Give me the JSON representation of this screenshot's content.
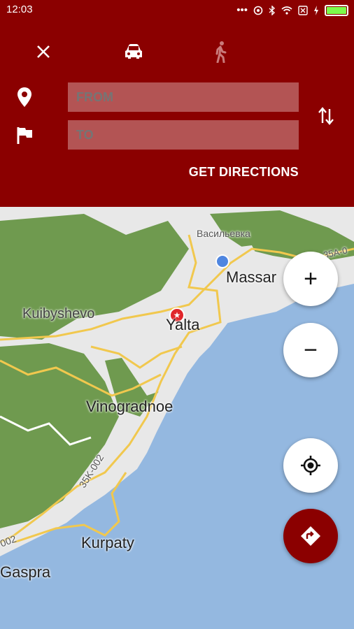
{
  "status_bar": {
    "time": "12:03",
    "battery_level": 1.0
  },
  "header": {
    "transport_modes": [
      "car-icon",
      "walk-icon"
    ],
    "from_placeholder": "FROM",
    "to_placeholder": "TO",
    "get_directions_label": "GET DIRECTIONS"
  },
  "map": {
    "labels": {
      "vasilyevka": "Васильевка",
      "massandra": "Massar",
      "kuibyshevo": "Kuibyshevo",
      "yalta": "Yalta",
      "vinogradnoe": "Vinogradnoe",
      "road_35k002": "35K-002",
      "road_35a": "35A-0",
      "road_002": "002",
      "kurpaty": "Kurpaty",
      "gaspra": "Gaspra"
    },
    "colors": {
      "water": "#94b8e0",
      "forest": "#6f9a4f",
      "urban": "#e8e8e8",
      "roads": "#f1c84e"
    }
  },
  "controls": {
    "zoom_in": "+",
    "zoom_out": "−"
  },
  "accent_color": "#8b0000"
}
